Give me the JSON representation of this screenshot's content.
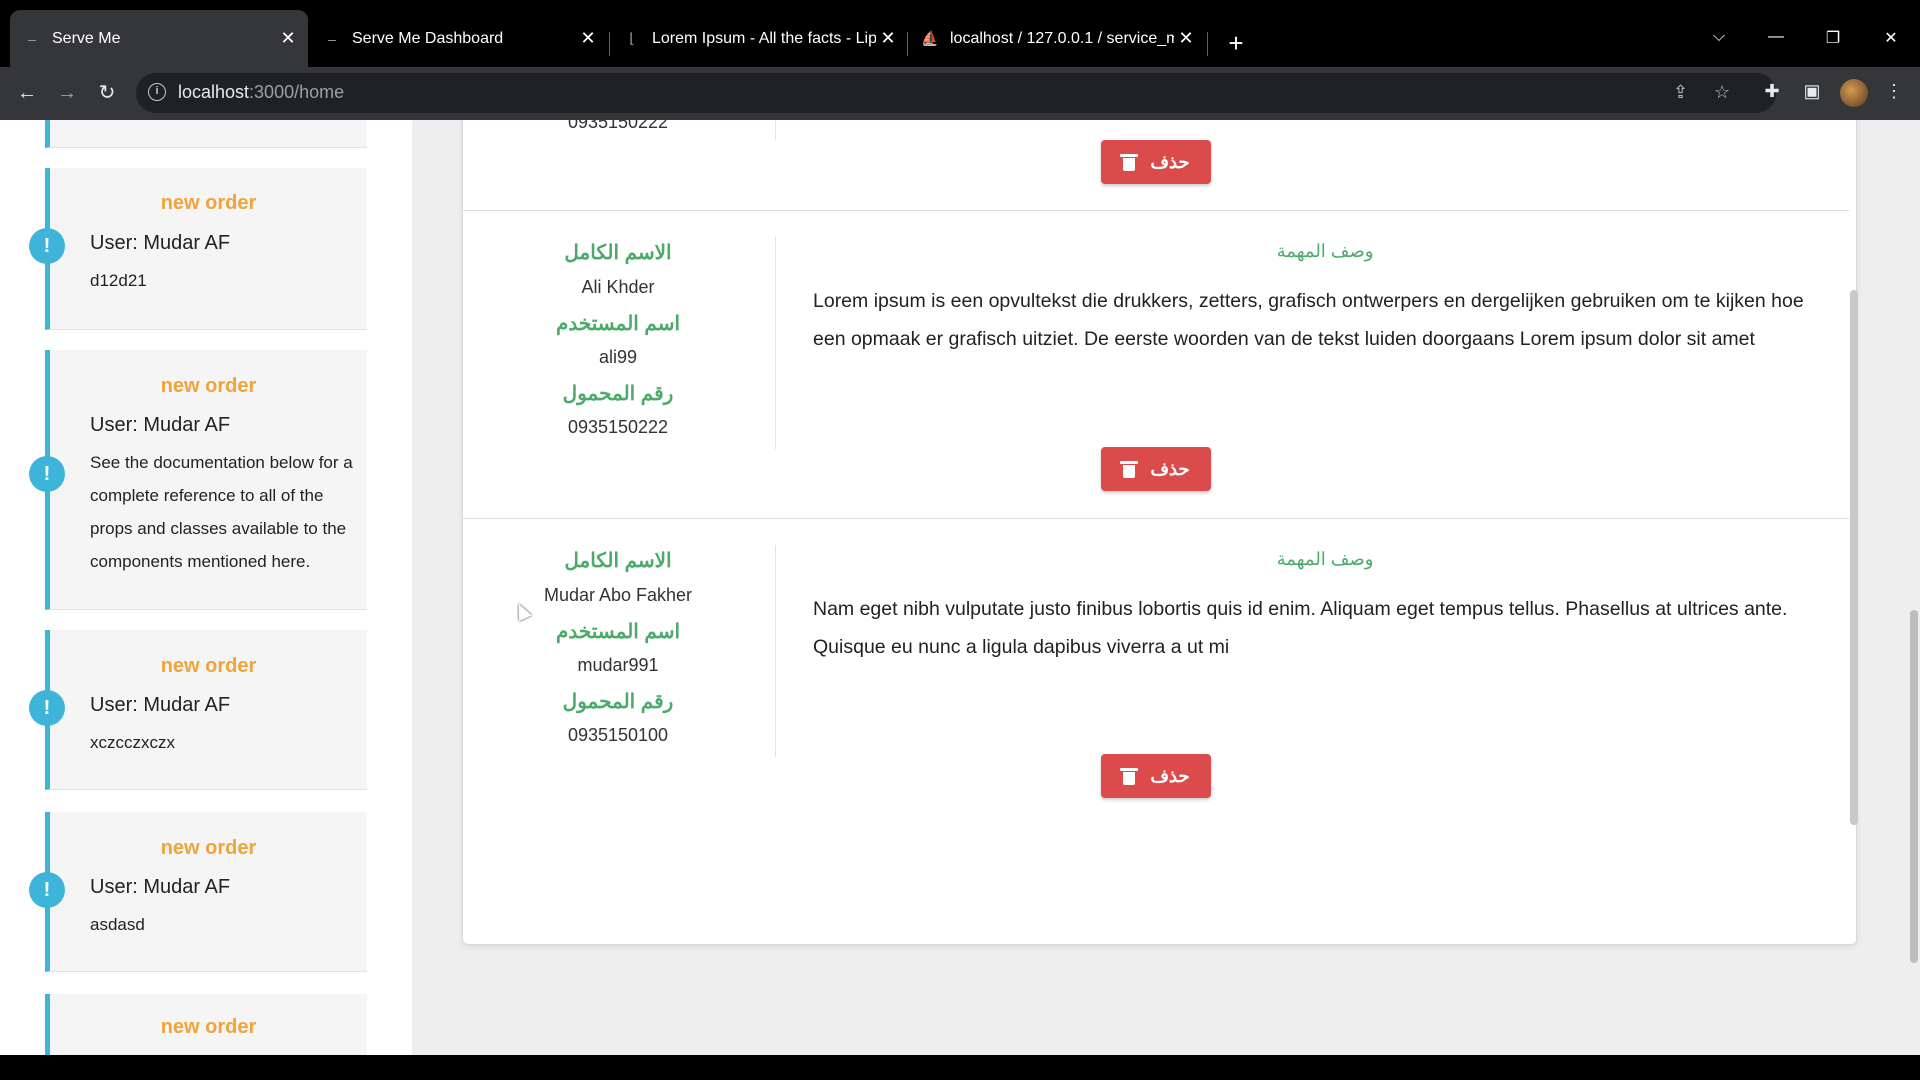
{
  "browser": {
    "tabs": [
      {
        "title": "Serve Me",
        "icon": "loading-dash-icon",
        "active": true
      },
      {
        "title": "Serve Me Dashboard",
        "icon": "loading-dash-icon",
        "active": false
      },
      {
        "title": "Lorem Ipsum - All the facts - Lip",
        "icon": "lipsum-icon",
        "active": false
      },
      {
        "title": "localhost / 127.0.0.1 / service_m",
        "icon": "phpmyadmin-icon",
        "active": false
      }
    ],
    "url_host": "localhost",
    "url_path": ":3000/home"
  },
  "sidebar": {
    "notifications": [
      {
        "title": "new order",
        "user": "User: Mudar AF",
        "message": "d12d21"
      },
      {
        "title": "new order",
        "user": "User: Mudar AF",
        "message": "See the documentation below for a complete reference to all of the props and classes available to the components mentioned here."
      },
      {
        "title": "new order",
        "user": "User: Mudar AF",
        "message": "xczcczxczx"
      },
      {
        "title": "new order",
        "user": "User: Mudar AF",
        "message": "asdasd"
      },
      {
        "title": "new order"
      }
    ],
    "badge_symbol": "!"
  },
  "tasks": {
    "labels": {
      "full_name": "الاسم الكامل",
      "username": "اسم المستخدم",
      "phone": "رقم المحمول",
      "task_desc": "وصف المهمة",
      "delete": "حذف"
    },
    "partial_top_phone": "0935150222",
    "rows": [
      {
        "full_name": "Ali Khder",
        "username": "ali99",
        "phone": "0935150222",
        "description": "Lorem ipsum is een opvultekst die drukkers, zetters, grafisch ontwerpers en dergelijken gebruiken om te kijken hoe een opmaak er grafisch uitziet. De eerste woorden van de tekst luiden doorgaans Lorem ipsum dolor sit amet"
      },
      {
        "full_name": "Mudar Abo Fakher",
        "username": "mudar991",
        "phone": "0935150100",
        "description": "Nam eget nibh vulputate justo finibus lobortis quis id enim. Aliquam eget tempus tellus. Phasellus at ultrices ante. Quisque eu nunc a ligula dapibus viverra a ut mi"
      }
    ]
  },
  "colors": {
    "accent_blue": "#3fb4d9",
    "order_orange": "#f0a43a",
    "label_green": "#4cab6b",
    "delete_red": "#dc4b4b"
  }
}
